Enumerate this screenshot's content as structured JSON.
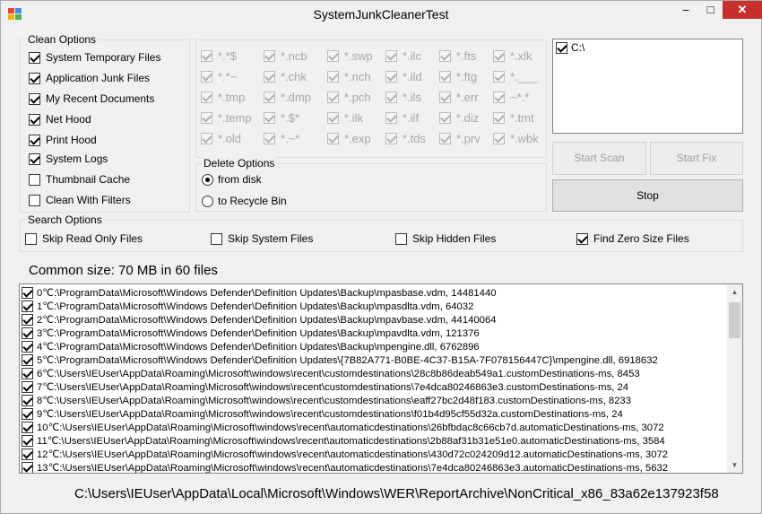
{
  "window": {
    "title": "SystemJunkCleanerTest",
    "minimize": "‒",
    "maximize": "□",
    "close": "✕"
  },
  "clean_options": {
    "legend": "Clean Options",
    "items": [
      {
        "label": "System Temporary Files",
        "checked": true
      },
      {
        "label": "Application Junk Files",
        "checked": true
      },
      {
        "label": "My Recent Documents",
        "checked": true
      },
      {
        "label": "Net Hood",
        "checked": true
      },
      {
        "label": "Print Hood",
        "checked": true
      },
      {
        "label": "System Logs",
        "checked": true
      },
      {
        "label": "Thumbnail Cache",
        "checked": false
      },
      {
        "label": "Clean With Filters",
        "checked": false
      }
    ]
  },
  "filters": [
    "*.*$",
    "*.ncb",
    "*.swp",
    "*.ilc",
    "*.fts",
    "*.xlk",
    "*.*~",
    "*.chk",
    "*.nch",
    "*.ild",
    "*.ftg",
    "*.___",
    "*.tmp",
    "*.dmp",
    "*.pch",
    "*.ils",
    "*.err",
    "~*.*",
    "*.temp",
    "*.$*",
    "*.ilk",
    "*.ilf",
    "*.diz",
    "*.tmt",
    "*.old",
    "*.~*",
    "*.exp",
    "*.tds",
    "*.prv",
    "*.wbk"
  ],
  "delete_options": {
    "legend": "Delete Options",
    "from_disk": "from disk",
    "recycle_bin": "to Recycle Bin",
    "selected": "from_disk"
  },
  "drives": [
    {
      "label": "C:\\",
      "checked": true
    }
  ],
  "buttons": {
    "start_scan": "Start Scan",
    "start_fix": "Start Fix",
    "stop": "Stop"
  },
  "search_options": {
    "legend": "Search Options",
    "items": [
      {
        "label": "Skip Read Only Files",
        "checked": false
      },
      {
        "label": "Skip System Files",
        "checked": false
      },
      {
        "label": "Skip Hidden Files",
        "checked": false
      },
      {
        "label": "Find Zero Size Files",
        "checked": true
      }
    ]
  },
  "summary": "Common size: 70 MB in 60 files",
  "files": [
    "0℃:\\ProgramData\\Microsoft\\Windows Defender\\Definition Updates\\Backup\\mpasbase.vdm, 14481440",
    "1℃:\\ProgramData\\Microsoft\\Windows Defender\\Definition Updates\\Backup\\mpasdlta.vdm, 64032",
    "2℃:\\ProgramData\\Microsoft\\Windows Defender\\Definition Updates\\Backup\\mpavbase.vdm, 44140064",
    "3℃:\\ProgramData\\Microsoft\\Windows Defender\\Definition Updates\\Backup\\mpavdlta.vdm, 121376",
    "4℃:\\ProgramData\\Microsoft\\Windows Defender\\Definition Updates\\Backup\\mpengine.dll, 6762896",
    "5℃:\\ProgramData\\Microsoft\\Windows Defender\\Definition Updates\\{7B82A771-B0BE-4C37-B15A-7F078156447C}\\mpengine.dll, 6918632",
    "6℃:\\Users\\IEUser\\AppData\\Roaming\\Microsoft\\windows\\recent\\customdestinations\\28c8b86deab549a1.customDestinations-ms, 8453",
    "7℃:\\Users\\IEUser\\AppData\\Roaming\\Microsoft\\windows\\recent\\customdestinations\\7e4dca80246863e3.customDestinations-ms, 24",
    "8℃:\\Users\\IEUser\\AppData\\Roaming\\Microsoft\\windows\\recent\\customdestinations\\eaff27bc2d48f183.customDestinations-ms, 8233",
    "9℃:\\Users\\IEUser\\AppData\\Roaming\\Microsoft\\windows\\recent\\customdestinations\\f01b4d95cf55d32a.customDestinations-ms, 24",
    "10℃:\\Users\\IEUser\\AppData\\Roaming\\Microsoft\\windows\\recent\\automaticdestinations\\26bfbdac8c66cb7d.automaticDestinations-ms, 3072",
    "11℃:\\Users\\IEUser\\AppData\\Roaming\\Microsoft\\windows\\recent\\automaticdestinations\\2b88af31b31e51e0.automaticDestinations-ms, 3584",
    "12℃:\\Users\\IEUser\\AppData\\Roaming\\Microsoft\\windows\\recent\\automaticdestinations\\430d72c024209d12.automaticDestinations-ms, 3072",
    "13℃:\\Users\\IEUser\\AppData\\Roaming\\Microsoft\\windows\\recent\\automaticdestinations\\7e4dca80246863e3.automaticDestinations-ms, 5632"
  ],
  "status_path": "C:\\Users\\IEUser\\AppData\\Local\\Microsoft\\Windows\\WER\\ReportArchive\\NonCritical_x86_83a62e137923f58"
}
